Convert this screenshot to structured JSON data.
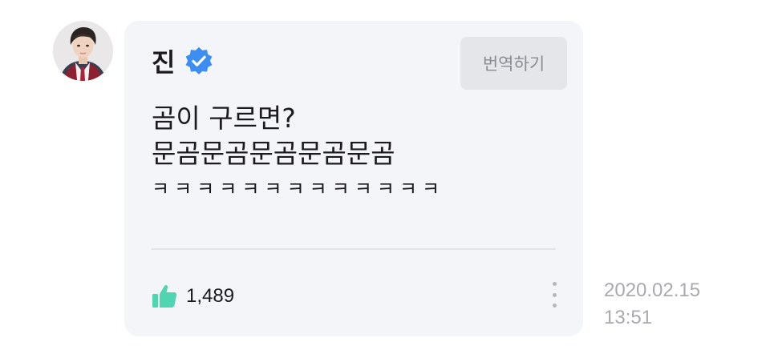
{
  "post": {
    "author": {
      "name": "진",
      "verified_icon": "verified-badge-icon",
      "avatar_icon": "profile-photo"
    },
    "translate_label": "번역하기",
    "text_lines": [
      "곰이 구르면?",
      "문곰문곰문곰문곰문곰",
      "ㅋㅋㅋㅋㅋㅋㅋㅋㅋㅋㅋㅋㅋ"
    ],
    "likes": "1,489",
    "like_icon": "thumbs-up-icon",
    "more_icon": "more-vertical-icon",
    "date": "2020.02.15",
    "time": "13:51"
  },
  "colors": {
    "bubble_bg": "#f4f5f9",
    "verified": "#3d8ef2",
    "like": "#4fd6b0",
    "muted": "#a9aab0"
  }
}
